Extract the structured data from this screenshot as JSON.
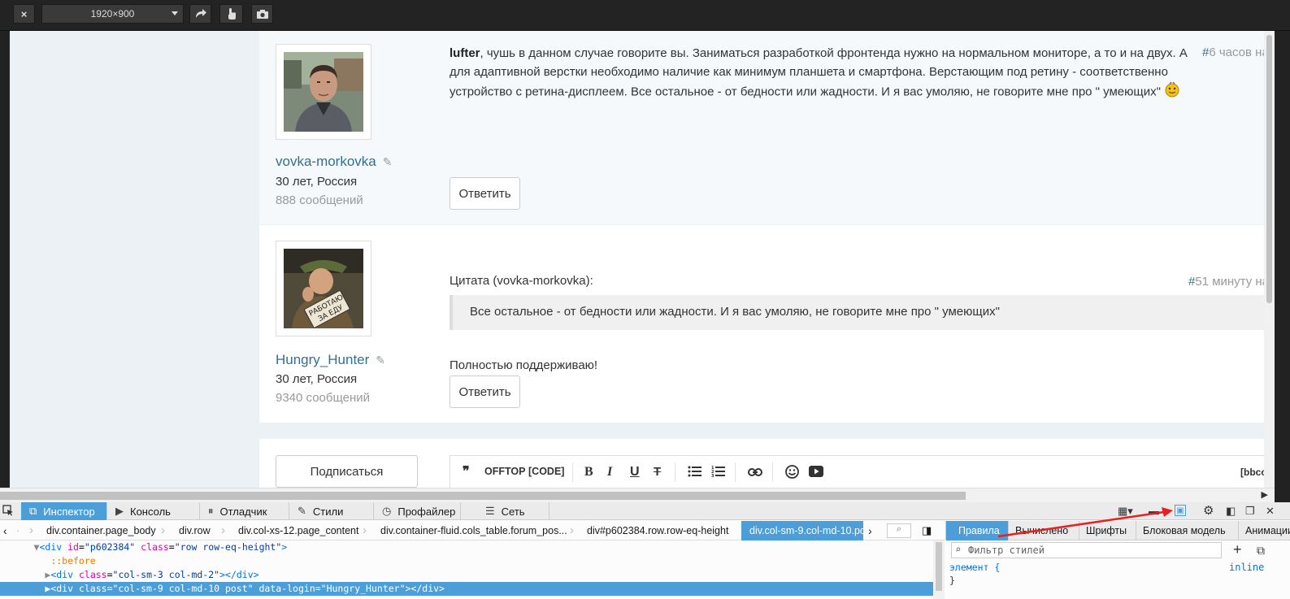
{
  "toolbar": {
    "close_glyph": "×",
    "viewport_size": "1920×900"
  },
  "posts": [
    {
      "username": "vovka-morkovka",
      "age_location": "30 лет, Россия",
      "message_count": "888 сообщений",
      "mention": "lufter",
      "text": ", чушь в данном случае говорите вы. Заниматься разработкой  фронтенда нужно на нормальном мониторе, а то и на двух. А для адаптивной верстки необходимо наличие как минимум планшета и смартфона. Верстающим под ретину - соответственно устройство с ретина-дисплеем. Все остальное - от бедности или жадности. И я вас умоляю, не говорите мне про \" умеющих\"",
      "hash": "#",
      "time": "6 часов на",
      "reply_label": "Ответить"
    },
    {
      "username": "Hungry_Hunter",
      "age_location": "30 лет, Россия",
      "message_count": "9340 сообщений",
      "quote_title": "Цитата (vovka-morkovka):",
      "quote_text": "Все остальное - от бедности или жадности. И я вас умоляю, не говорите мне про \" умеющих\"",
      "text": "Полностью поддерживаю!",
      "hash": "#",
      "time": "51 минуту на",
      "reply_label": "Ответить"
    }
  ],
  "editor": {
    "subscribe_label": "Подписаться",
    "quote_glyph": "❞",
    "offtop": "OFFTOP",
    "code": "[CODE]",
    "bold": "B",
    "italic": "I",
    "underline": "U",
    "strike": "T",
    "bbcode": "[bbcod"
  },
  "devtools": {
    "tabs": [
      {
        "label": "Инспектор",
        "icon": "inspector-icon"
      },
      {
        "label": "Консоль",
        "icon": "console-icon"
      },
      {
        "label": "Отладчик",
        "icon": "debugger-icon"
      },
      {
        "label": "Стили",
        "icon": "style-editor-icon"
      },
      {
        "label": "Профайлер",
        "icon": "profiler-icon"
      },
      {
        "label": "Сеть",
        "icon": "network-icon"
      }
    ],
    "breadcrumbs": [
      "div.container.page_body",
      "div.row",
      "div.col-xs-12.page_content",
      "div.container-fluid.cols_table.forum_pos...",
      "div#p602384.row.row-eq-height",
      "div.col-sm-9.col-md-10.po"
    ],
    "markup": {
      "line1_tag_open": "<div",
      "line1_id_attr": "id",
      "line1_id_val": "\"p602384\"",
      "line1_class_attr": "class",
      "line1_class_val": "\"row row-eq-height\"",
      "line1_close": ">",
      "line2": "::before",
      "line3_open": "<div",
      "line3_attr": "class",
      "line3_val": "\"col-sm-3 col-md-2\"",
      "line3_close": "></div>",
      "line4": "<div class=\"col-sm-9 col-md-10 post\" data-login=\"Hungry_Hunter\"></div>"
    },
    "side_tabs": [
      "Правила",
      "Вычислено",
      "Шрифты",
      "Блоковая модель",
      "Анимации"
    ],
    "filter_placeholder": "Фильтр стилей",
    "rule_selector": "элемент {",
    "rule_close": "}",
    "rule_source": "inline"
  },
  "colors": {
    "accent": "#4c9ed9",
    "link": "#31708f",
    "arrow": "#e82020"
  }
}
